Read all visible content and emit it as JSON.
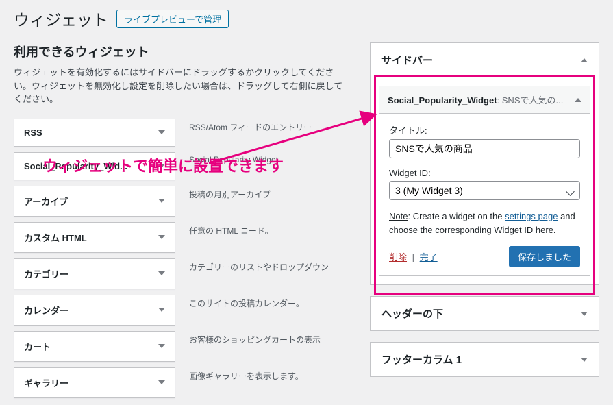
{
  "header": {
    "title": "ウィジェット",
    "live_preview": "ライブプレビューで管理"
  },
  "available": {
    "title": "利用できるウィジェット",
    "help": "ウィジェットを有効化するにはサイドバーにドラッグするかクリックしてください。ウィジェットを無効化し設定を削除したい場合は、ドラッグして右側に戻してください。"
  },
  "widgets": [
    {
      "label": "RSS",
      "desc": "RSS/Atom フィードのエントリー"
    },
    {
      "label": "Social_Popularity_Wid...",
      "desc": "Social Popularity Widget"
    },
    {
      "label": "アーカイブ",
      "desc": "投稿の月別アーカイブ"
    },
    {
      "label": "カスタム HTML",
      "desc": "任意の HTML コード。"
    },
    {
      "label": "カテゴリー",
      "desc": "カテゴリーのリストやドロップダウン"
    },
    {
      "label": "カレンダー",
      "desc": "このサイトの投稿カレンダー。"
    },
    {
      "label": "カート",
      "desc": "お客様のショッピングカートの表示"
    },
    {
      "label": "ギャラリー",
      "desc": "画像ギャラリーを表示します。"
    }
  ],
  "sidebar_areas": [
    {
      "title": "サイドバー",
      "open": true
    },
    {
      "title": "ヘッダーの下",
      "open": false
    },
    {
      "title": "フッターカラム 1",
      "open": false
    }
  ],
  "instance": {
    "name": "Social_Popularity_Widget",
    "desc": "SNSで人気の...",
    "form": {
      "title_label": "タイトル:",
      "title_value": "SNSで人気の商品",
      "widgetid_label": "Widget ID:",
      "widgetid_value": "3 (My Widget 3)",
      "note_prefix": "Note",
      "note_1": ": Create a widget on the ",
      "note_link": "settings page",
      "note_2": " and choose the corresponding Widget ID here.",
      "delete": "削除",
      "done": "完了",
      "save": "保存しました"
    }
  },
  "callout": "ウィジェットで簡単に設置できます"
}
